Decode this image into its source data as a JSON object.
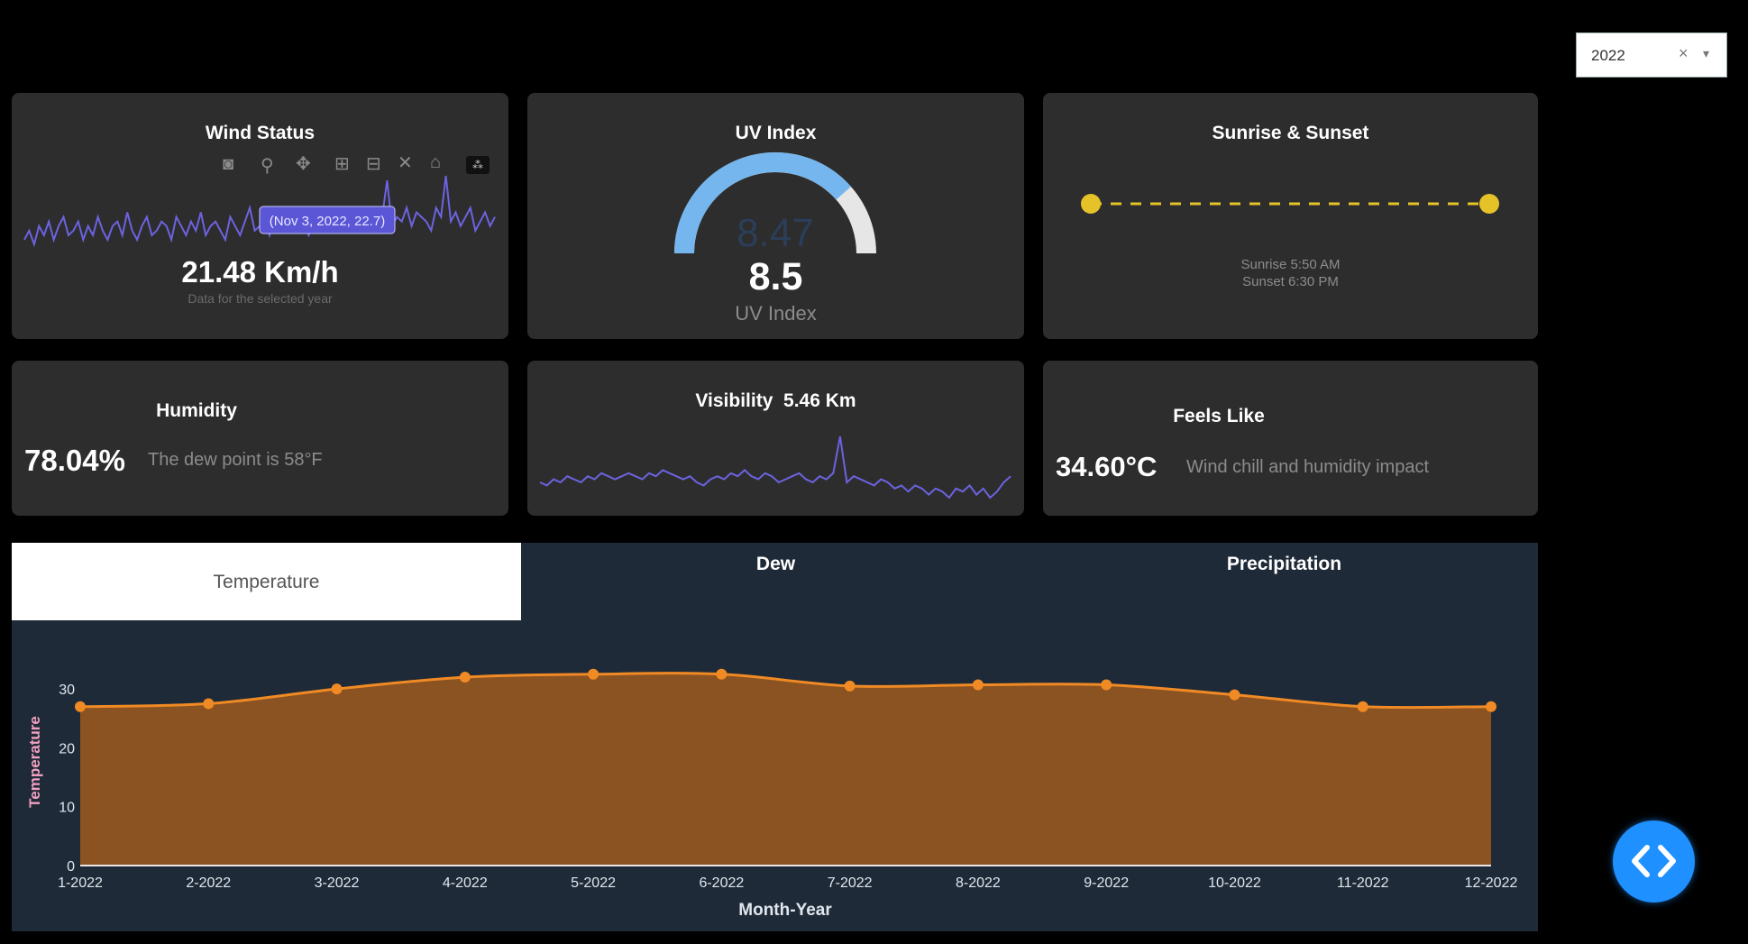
{
  "year_filter": {
    "value": "2022",
    "clear_icon": "close-icon",
    "arrow_icon": "chevron-down-icon"
  },
  "wind": {
    "title": "Wind Status",
    "value": "21.48 Km/h",
    "caption": "Data for the selected year",
    "tooltip": "(Nov 3, 2022, 22.7)",
    "series": [
      9,
      11,
      8,
      12,
      10,
      13,
      9,
      12,
      14,
      10,
      11,
      13,
      9,
      12,
      10,
      14,
      11,
      9,
      12,
      13,
      10,
      15,
      11,
      9,
      12,
      14,
      10,
      11,
      13,
      12,
      9,
      14,
      12,
      10,
      13,
      11,
      15,
      10,
      12,
      13,
      11,
      9,
      14,
      12,
      10,
      13,
      16,
      11,
      12,
      14,
      10,
      13,
      12,
      15,
      11,
      12,
      14,
      13,
      10,
      12,
      15,
      11,
      14,
      13,
      12,
      16,
      11,
      13,
      14,
      12,
      15,
      13,
      11,
      14,
      22,
      12,
      14,
      13,
      16,
      12,
      15,
      14,
      13,
      11,
      16,
      14,
      23,
      13,
      15,
      12,
      14,
      16,
      11,
      13,
      15,
      12,
      14
    ]
  },
  "uv": {
    "title": "UV Index",
    "value": "8.5",
    "gauge_value": 8.47,
    "gauge_max": 11,
    "ghost": "8.47",
    "label": "UV Index"
  },
  "sun": {
    "title": "Sunrise & Sunset",
    "sunrise": "Sunrise 5:50 AM",
    "sunset": "Sunset 6:30 PM",
    "dot_color": "#e6c229"
  },
  "humidity": {
    "title": "Humidity",
    "value": "78.04%",
    "caption": "The dew point is 58°F"
  },
  "visibility": {
    "title": "Visibility  5.46 Km",
    "series": [
      5.4,
      5.3,
      5.5,
      5.4,
      5.6,
      5.5,
      5.4,
      5.6,
      5.5,
      5.7,
      5.6,
      5.5,
      5.6,
      5.7,
      5.6,
      5.5,
      5.7,
      5.6,
      5.8,
      5.7,
      5.6,
      5.5,
      5.6,
      5.4,
      5.3,
      5.5,
      5.6,
      5.5,
      5.7,
      5.6,
      5.8,
      5.6,
      5.5,
      5.7,
      5.6,
      5.4,
      5.5,
      5.6,
      5.7,
      5.5,
      5.4,
      5.6,
      5.5,
      5.7,
      6.9,
      5.4,
      5.6,
      5.5,
      5.4,
      5.3,
      5.5,
      5.4,
      5.2,
      5.3,
      5.1,
      5.3,
      5.2,
      5.0,
      5.2,
      5.1,
      4.9,
      5.2,
      5.1,
      5.3,
      5.0,
      5.2,
      4.9,
      5.1,
      5.4,
      5.6
    ]
  },
  "feels_like": {
    "title": "Feels Like",
    "value": "34.60°C",
    "caption": "Wind chill and humidity impact"
  },
  "tabs": [
    {
      "label": "Temperature",
      "active": true
    },
    {
      "label": "Dew",
      "active": false
    },
    {
      "label": "Precipitation",
      "active": false
    }
  ],
  "chart_data": {
    "type": "area",
    "x": [
      "1-2022",
      "2-2022",
      "3-2022",
      "4-2022",
      "5-2022",
      "6-2022",
      "7-2022",
      "8-2022",
      "9-2022",
      "10-2022",
      "11-2022",
      "12-2022"
    ],
    "values": [
      27,
      27.5,
      30,
      32,
      32.5,
      32.5,
      30.5,
      30.7,
      30.7,
      29,
      27,
      27
    ],
    "xlabel": "Month-Year",
    "ylabel": "Temperature",
    "yticks": [
      0,
      10,
      20,
      30
    ],
    "ylim": [
      0,
      34
    ],
    "fill_color": "#8b5222",
    "line_color": "#f08a24",
    "grid": false
  }
}
